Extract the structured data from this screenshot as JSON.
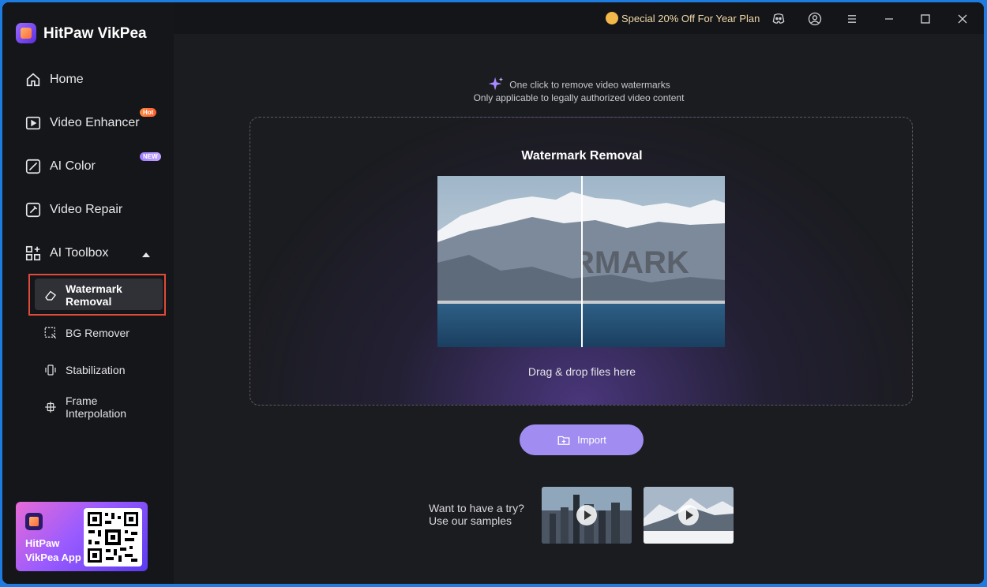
{
  "app": {
    "title": "HitPaw VikPea"
  },
  "titlebar": {
    "promo": "Special 20% Off For Year Plan"
  },
  "sidebar": {
    "items": [
      {
        "label": "Home"
      },
      {
        "label": "Video Enhancer",
        "badge": "Hot"
      },
      {
        "label": "AI Color",
        "badge": "NEW"
      },
      {
        "label": "Video Repair"
      },
      {
        "label": "AI Toolbox"
      }
    ],
    "subitems": [
      {
        "label": "Watermark Removal"
      },
      {
        "label": "BG Remover"
      },
      {
        "label": "Stabilization"
      },
      {
        "label": "Frame Interpolation"
      }
    ],
    "promo": {
      "line1": "HitPaw",
      "line2": "VikPea App"
    }
  },
  "main": {
    "hint1": "One click to remove video watermarks",
    "hint2": "Only applicable to legally authorized video content",
    "drop_title": "Watermark Removal",
    "watermark_text": "RMARK",
    "drop_text": "Drag & drop files here",
    "import_label": "Import",
    "samples_line1": "Want to have a try?",
    "samples_line2": "Use our samples"
  },
  "colors": {
    "accent": "#a18df2",
    "highlight": "#e04a3a"
  }
}
